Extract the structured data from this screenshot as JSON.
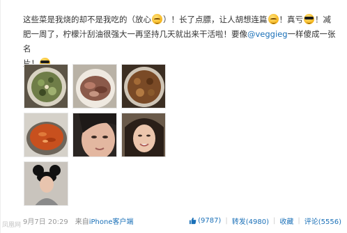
{
  "post": {
    "text_line1_a": "这些菜是我烧的却不是我吃的（放心",
    "text_line1_b": "）！长了点膘，让人胡想连篇",
    "text_line1_c": "！真亏",
    "text_line1_d": "！减肥",
    "text_line2_a": "一周了，柠檬汁刮油很强大一再坚持几天就出来干活啦！要像",
    "mention": "@veggieg",
    "text_line2_b": "一样傻成一张名",
    "text_line3_a": "片！"
  },
  "images": [
    {
      "alt": "salad dish"
    },
    {
      "alt": "stir-fried dish"
    },
    {
      "alt": "stew dish"
    },
    {
      "alt": "soup in wok"
    },
    {
      "alt": "selfie close-up"
    },
    {
      "alt": "selfie smiling"
    },
    {
      "alt": "photo with mouse ears hat"
    }
  ],
  "meta": {
    "time": "9月7日 20:29",
    "source_prefix": "来自",
    "source_link": "iPhone客户端"
  },
  "actions": {
    "like": "(9787)",
    "repost": "转发(4980)",
    "favorite": "收藏",
    "comment": "评论(5556)"
  },
  "watermark": "凤凰网",
  "colors": {
    "link": "#1a70b8",
    "text": "#333333",
    "meta": "#999999"
  }
}
